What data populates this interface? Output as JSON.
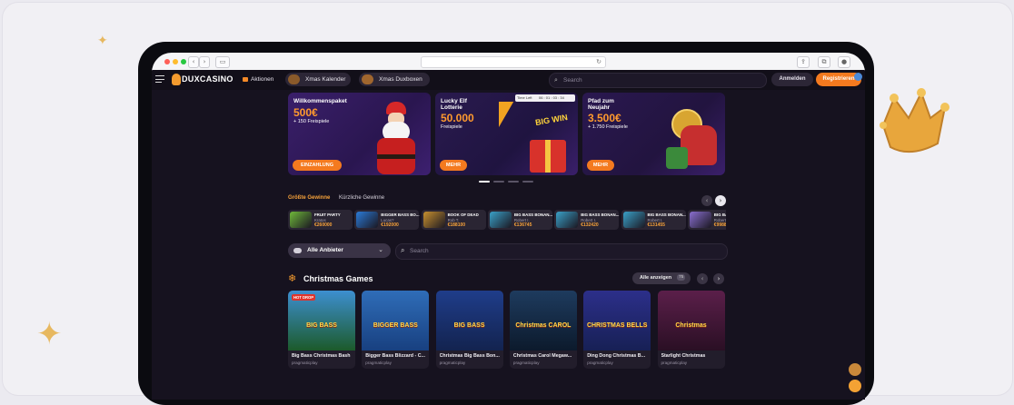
{
  "nav": {
    "logo": "DUXCASINO",
    "promotions": "Aktionen",
    "xmas_calendar": "Xmas Kalender",
    "xmas_boxes": "Xmas Duxboxen",
    "search_placeholder": "Search",
    "login": "Anmelden",
    "register": "Registrieren"
  },
  "banners": [
    {
      "title1": "Willkommenspaket",
      "amount": "500€",
      "sub": "+ 150 Freispiele",
      "cta": "EINZAHLUNG"
    },
    {
      "title1": "Lucky Elf",
      "title2": "Lotterie",
      "amount": "50.000",
      "sub": "Freispiele",
      "cta": "MEHR",
      "badge": "BIG WIN",
      "timer_label": "Time Left",
      "timer": "06 : 01 : 03 : 34"
    },
    {
      "title1": "Pfad zum",
      "title2": "Neujahr",
      "amount": "3.500€",
      "sub": "+ 1.750 Freispiele",
      "cta": "MEHR"
    }
  ],
  "wins": {
    "tab_active": "Größte Gewinne",
    "tab_inactive": "Kürzliche Gewinne",
    "items": [
      {
        "game": "FRUIT PARTY",
        "user": "Kratos",
        "amount": "€260000",
        "color": "#6fb83a"
      },
      {
        "game": "BIGGER BASS BO...",
        "user": "Lucas?",
        "amount": "€192000",
        "color": "#2b7bd8"
      },
      {
        "game": "BOOK OF DEAD",
        "user": "Rob T.",
        "amount": "€188100",
        "color": "#c7902f"
      },
      {
        "game": "BIG BASS BONAN...",
        "user": "Robert I.",
        "amount": "€136745",
        "color": "#3aa0c8"
      },
      {
        "game": "BIG BASS BONAN...",
        "user": "Robert I.",
        "amount": "€132420",
        "color": "#3aa0c8"
      },
      {
        "game": "BIG BASS BONAN...",
        "user": "Robert I.",
        "amount": "€131455",
        "color": "#3aa0c8"
      },
      {
        "game": "BIG BASS",
        "user": "Robert I.",
        "amount": "€99881",
        "color": "#8a6fd0"
      }
    ]
  },
  "filter": {
    "providers": "Alle Anbieter",
    "search_placeholder": "Search"
  },
  "christmas": {
    "title": "Christmas Games",
    "show_all": "Alle anzeigen",
    "count": "75",
    "games": [
      {
        "name": "Big Bass Christmas Bash",
        "provider": "pragmaticplay",
        "thumb_title": "BIG BASS",
        "badge": "HOT DROP",
        "color1": "#3d8fd0",
        "color2": "#1c5a2a"
      },
      {
        "name": "Bigger Bass Blizzard - C...",
        "provider": "pragmaticplay",
        "thumb_title": "BIGGER BASS",
        "color1": "#2f6db8",
        "color2": "#184080"
      },
      {
        "name": "Christmas Big Bass Bon...",
        "provider": "pragmaticplay",
        "thumb_title": "BIG BASS",
        "color1": "#1f3d8a",
        "color2": "#13234f"
      },
      {
        "name": "Christmas Carol Megaw...",
        "provider": "pragmaticplay",
        "thumb_title": "Christmas CAROL",
        "color1": "#1e3b5e",
        "color2": "#0c1a2c"
      },
      {
        "name": "Ding Dong Christmas B...",
        "provider": "pragmaticplay",
        "thumb_title": "CHRISTMAS BELLS",
        "color1": "#2c2f8a",
        "color2": "#172055"
      },
      {
        "name": "Starlight Christmas",
        "provider": "pragmaticplay",
        "thumb_title": "Christmas",
        "color1": "#5b1f4a",
        "color2": "#2a0f24"
      }
    ]
  }
}
